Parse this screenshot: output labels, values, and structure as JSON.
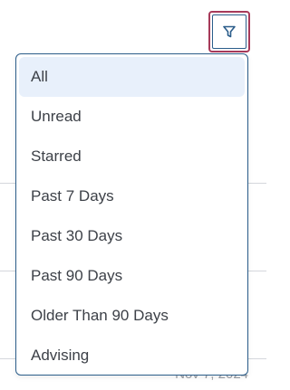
{
  "filter_button": {
    "icon": "filter-icon",
    "border_color": "#a73a5a",
    "inner_border_color": "#2b5d8a"
  },
  "dropdown": {
    "selected_background": "#e8f0fb",
    "options": [
      {
        "label": "All",
        "selected": true
      },
      {
        "label": "Unread",
        "selected": false
      },
      {
        "label": "Starred",
        "selected": false
      },
      {
        "label": "Past 7 Days",
        "selected": false
      },
      {
        "label": "Past 30 Days",
        "selected": false
      },
      {
        "label": "Past 90 Days",
        "selected": false
      },
      {
        "label": "Older Than 90 Days",
        "selected": false
      },
      {
        "label": "Advising",
        "selected": false
      }
    ]
  },
  "background": {
    "date_text": "Nov 7, 2024"
  }
}
